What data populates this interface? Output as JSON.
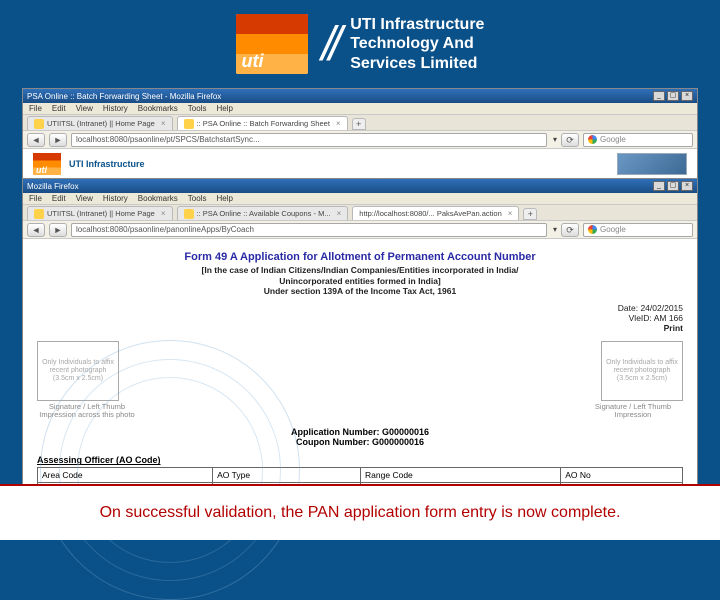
{
  "brand": {
    "logo_text": "uti",
    "name_line1": "UTI Infrastructure",
    "name_line2": "Technology And",
    "name_line3": "Services Limited"
  },
  "browser1": {
    "title": "PSA Online :: Batch Forwarding Sheet - Mozilla Firefox",
    "menu": [
      "File",
      "Edit",
      "View",
      "History",
      "Bookmarks",
      "Tools",
      "Help"
    ],
    "tabs": {
      "tab1": "UTIITSL (Intranet) || Home Page",
      "tab2": ":: PSA Online :: Batch Forwarding Sheet"
    },
    "url": "localhost:8080/psaonline/pt/SPCS/BatchstartSync...",
    "search_placeholder": "Google",
    "content_brand": "UTI Infrastructure"
  },
  "browser2": {
    "title": "Mozilla Firefox",
    "menu": [
      "File",
      "Edit",
      "View",
      "History",
      "Bookmarks",
      "Tools",
      "Help"
    ],
    "tabs": {
      "tab1": "UTIITSL (Intranet) || Home Page",
      "tab2": ":: PSA Online :: Available Coupons - M...",
      "tab3": "http://localhost:8080/... PaksAvePan.action"
    },
    "url": "localhost:8080/psaonline/panonlineApps/ByCoach",
    "search_placeholder": "Google"
  },
  "form": {
    "title": "Form 49 A Application for Allotment of Permanent Account Number",
    "subtitle_line1": "[In the case of Indian Citizens/Indian Companies/Entities incorporated in India/",
    "subtitle_line2": "Unincorporated entities formed in India]",
    "subtitle_line3": "Under section 139A of the Income Tax Act, 1961",
    "meta": {
      "date_label": "Date:",
      "date_value": "24/02/2015",
      "vleid_label": "VleID:",
      "vleid_value": "AM 166",
      "print": "Print"
    },
    "photo_left": "Only Individuals to affix recent photograph (3.5cm x 2.5cm)",
    "photo_right": "Only Individuals to affix recent photograph (3.5cm x 2.5cm)",
    "sig_left": "Signature / Left Thumb Impression across this photo",
    "sig_right": "Signature / Left Thumb Impression",
    "app_no_label": "Application Number:",
    "app_no_value": "G00000016",
    "coupon_label": "Coupon Number:",
    "coupon_value": "G000000016",
    "ao_header": "Assessing Officer (AO Code)",
    "ao_cols": [
      "Area Code",
      "AO Type",
      "Range Code",
      "AO No"
    ]
  },
  "footer": {
    "caption": "On successful validation, the PAN application form entry is now complete."
  }
}
